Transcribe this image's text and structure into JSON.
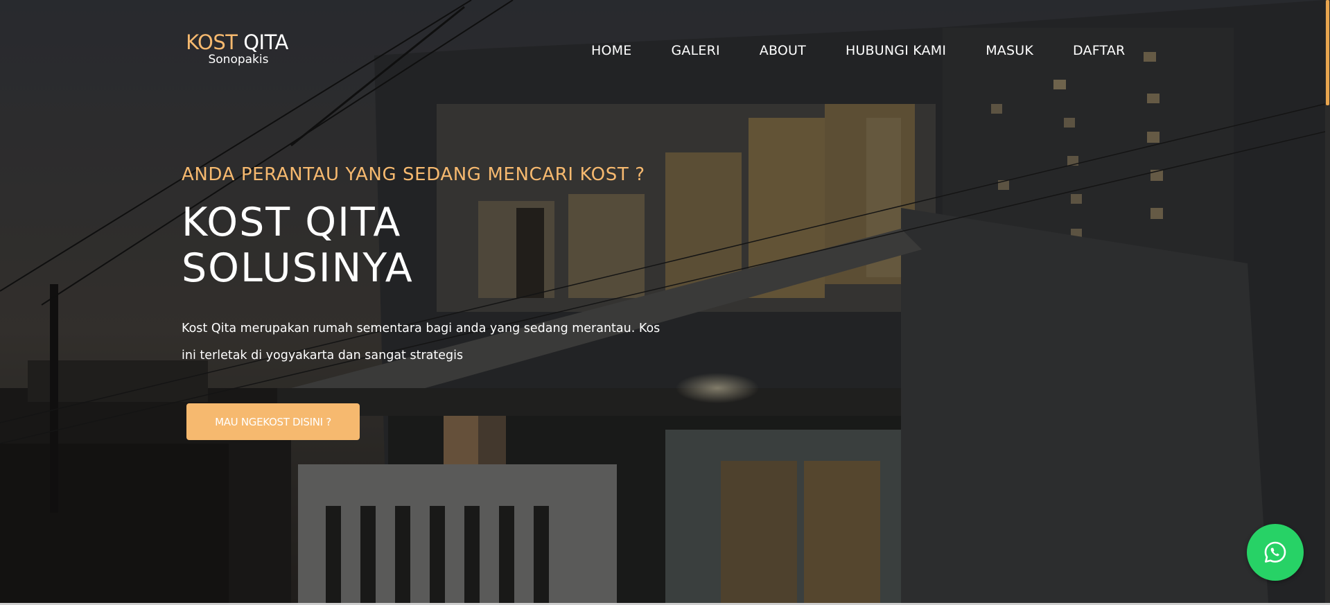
{
  "logo": {
    "main_accent": "KOST",
    "main_white": "QITA",
    "sub": "Sonopakis"
  },
  "nav": {
    "items": [
      "HOME",
      "GALERI",
      "ABOUT",
      "HUBUNGI KAMI",
      "MASUK",
      "DAFTAR"
    ]
  },
  "hero": {
    "eyebrow": "ANDA PERANTAU YANG SEDANG MENCARI KOST ?",
    "headline_line1": "KOST QITA",
    "headline_line2": "SOLUSINYA",
    "description": "Kost Qita merupakan rumah sementara bagi anda yang sedang merantau. Kos ini terletak di yogyakarta dan sangat strategis",
    "cta_label": "MAU NGEKOST DISINI ?"
  },
  "floating": {
    "icon": "whatsapp-icon"
  },
  "colors": {
    "accent": "#f6b96f",
    "whatsapp": "#27d266",
    "text": "#ffffff"
  }
}
